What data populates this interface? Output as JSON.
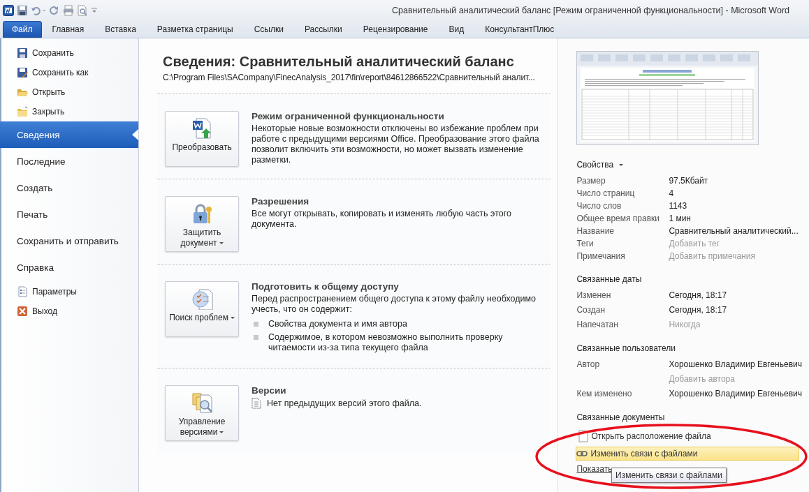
{
  "window": {
    "title": "Сравнительный аналитический баланс [Режим ограниченной функциональности]  -  Microsoft Word"
  },
  "ribbon_tabs": [
    {
      "label": "Файл",
      "selected": true
    },
    {
      "label": "Главная",
      "selected": false
    },
    {
      "label": "Вставка",
      "selected": false
    },
    {
      "label": "Разметка страницы",
      "selected": false
    },
    {
      "label": "Ссылки",
      "selected": false
    },
    {
      "label": "Рассылки",
      "selected": false
    },
    {
      "label": "Рецензирование",
      "selected": false
    },
    {
      "label": "Вид",
      "selected": false
    },
    {
      "label": "КонсультантПлюс",
      "selected": false
    }
  ],
  "backstage_nav": [
    {
      "label": "Сохранить",
      "kind": "command"
    },
    {
      "label": "Сохранить как",
      "kind": "command"
    },
    {
      "label": "Открыть",
      "kind": "command"
    },
    {
      "label": "Закрыть",
      "kind": "command"
    },
    {
      "label": "Сведения",
      "kind": "page",
      "selected": true
    },
    {
      "label": "Последние",
      "kind": "page",
      "selected": false
    },
    {
      "label": "Создать",
      "kind": "page",
      "selected": false
    },
    {
      "label": "Печать",
      "kind": "page",
      "selected": false
    },
    {
      "label": "Сохранить и отправить",
      "kind": "page",
      "selected": false
    },
    {
      "label": "Справка",
      "kind": "page",
      "selected": false
    },
    {
      "label": "Параметры",
      "kind": "command"
    },
    {
      "label": "Выход",
      "kind": "command"
    }
  ],
  "info": {
    "title": "Сведения: Сравнительный аналитический баланс",
    "path": "C:\\Program Files\\SACompany\\FinecAnalysis_2017\\fin\\report\\84612866522\\Сравнительный аналит...",
    "sections": [
      {
        "button": {
          "label": "Преобразовать",
          "dropdown": false
        },
        "heading": "Режим ограниченной функциональности",
        "text": "Некоторые новые возможности отключены во избежание проблем при работе с предыдущими версиями Office. Преобразование этого файла позволит включить эти возможности, но может вызвать изменение разметки."
      },
      {
        "button": {
          "label": "Защитить документ",
          "dropdown": true
        },
        "heading": "Разрешения",
        "text": "Все могут открывать, копировать и изменять любую часть этого документа."
      },
      {
        "button": {
          "label": "Поиск проблем",
          "dropdown": true
        },
        "heading": "Подготовить к общему доступу",
        "text": "Перед распространением общего доступа к этому файлу необходимо учесть, что он содержит:",
        "bullets": [
          "Свойства документа и имя автора",
          "Содержимое, в котором невозможно выполнить проверку читаемости из-за типа текущего файла"
        ]
      },
      {
        "button": {
          "label": "Управление версиями",
          "dropdown": true
        },
        "heading": "Версии",
        "note": "Нет предыдущих версий этого файла."
      }
    ]
  },
  "properties": {
    "heading": "Свойства",
    "groups": [
      {
        "rows": [
          {
            "label": "Размер",
            "value": "97.5Кбайт",
            "kind": "value"
          },
          {
            "label": "Число страниц",
            "value": "4",
            "kind": "value"
          },
          {
            "label": "Число слов",
            "value": "1143",
            "kind": "value"
          },
          {
            "label": "Общее время правки",
            "value": "1 мин",
            "kind": "value"
          },
          {
            "label": "Название",
            "value": "Сравнительный аналитический...",
            "kind": "value"
          },
          {
            "label": "Теги",
            "placeholder": "Добавить тег",
            "kind": "field"
          },
          {
            "label": "Примечания",
            "placeholder": "Добавить примечания",
            "kind": "field"
          }
        ]
      },
      {
        "heading": "Связанные даты",
        "rows": [
          {
            "label": "Изменен",
            "value": "Сегодня, 18:17",
            "kind": "value"
          },
          {
            "label": "Создан",
            "value": "Сегодня, 18:17",
            "kind": "value"
          },
          {
            "label": "Напечатан",
            "value": "Никогда",
            "kind": "empty"
          }
        ]
      },
      {
        "heading": "Связанные пользователи",
        "rows": [
          {
            "label": "Автор",
            "value": "Хорошенко Владимир Евгеньевич",
            "kind": "value"
          },
          {
            "placeholder": "Добавить автора",
            "kind": "field"
          },
          {
            "label": "Кем изменено",
            "value": "Хорошенко Владимир Евгеньевич",
            "kind": "value"
          }
        ]
      }
    ]
  },
  "related_documents": {
    "heading": "Связанные документы",
    "links": [
      {
        "label": "Открыть расположение файла",
        "highlighted": false
      },
      {
        "label": "Изменить связи с файлами",
        "highlighted": true
      }
    ],
    "show_all": "Показать"
  },
  "tooltip": "Изменить связи с файлами",
  "annotation": {
    "kind": "ellipse"
  }
}
